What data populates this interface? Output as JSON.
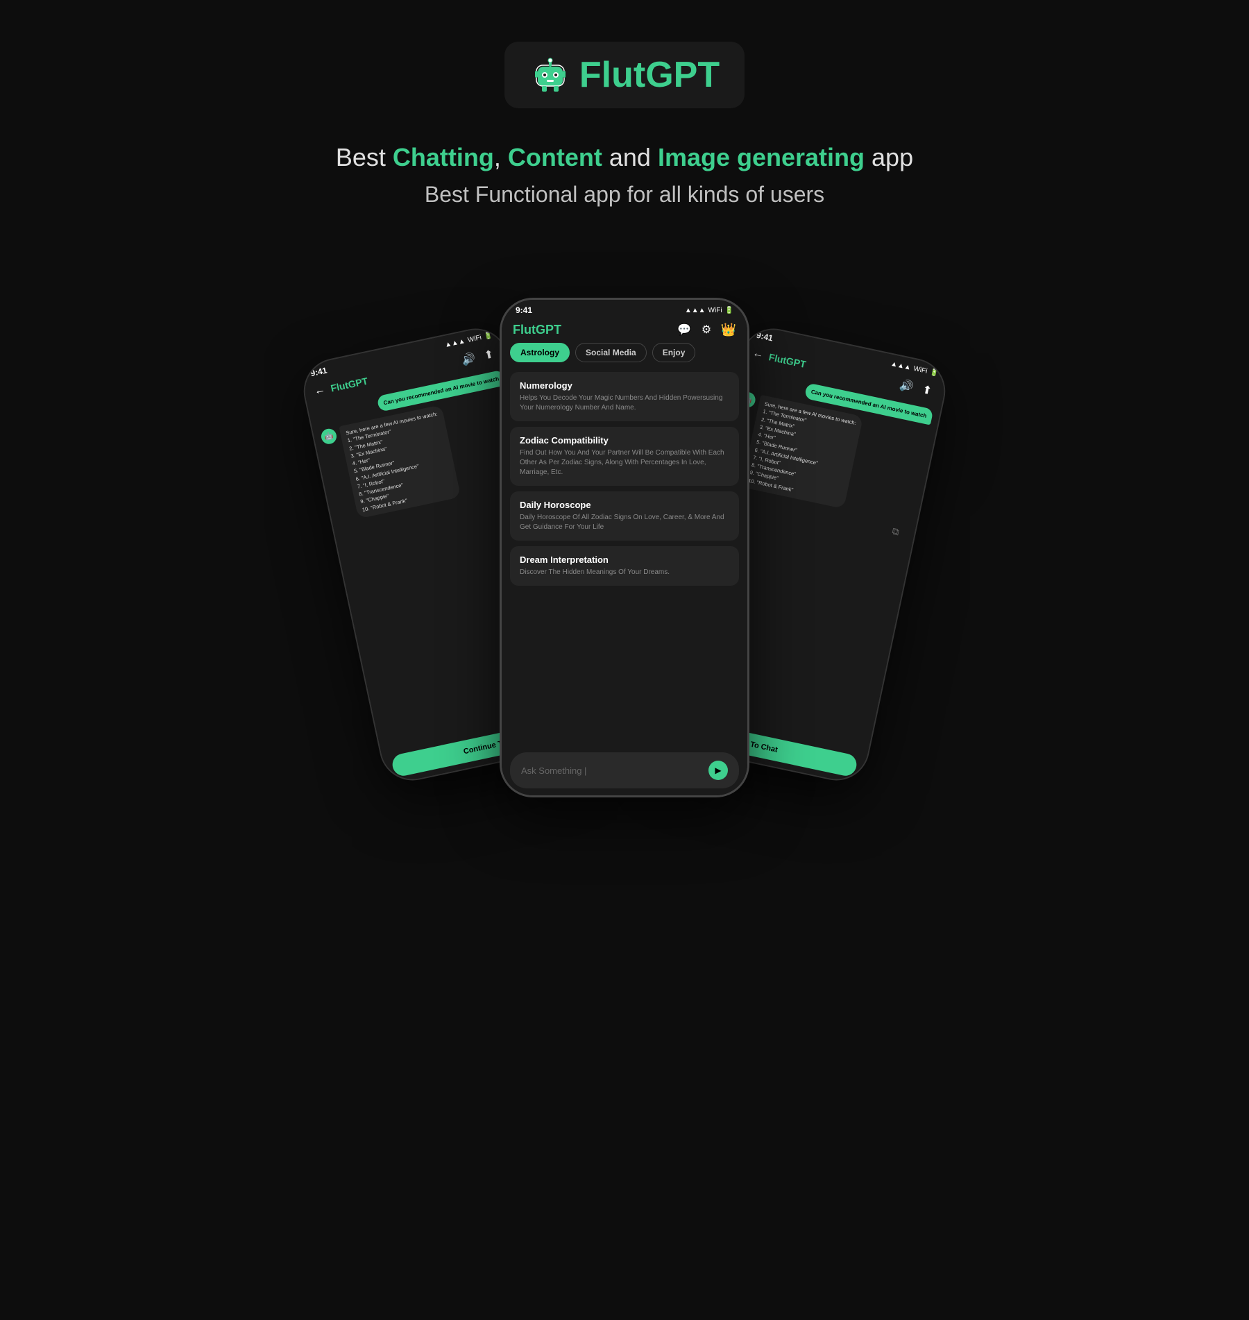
{
  "logo": {
    "text_white": "Flut",
    "text_green": "GPT"
  },
  "tagline1": {
    "prefix": "Best ",
    "word1": "Chatting",
    "sep1": ", ",
    "word2": "Content",
    "sep2": " and ",
    "word3": "Image generating",
    "suffix": " app"
  },
  "tagline2": "Best Functional app for all kinds of users",
  "center_phone": {
    "status_time": "9:41",
    "app_name_white": "Flut",
    "app_name_green": "GPT",
    "tabs": [
      "Astrology",
      "Social Media",
      "Enjoy"
    ],
    "active_tab": 0,
    "categories": [
      {
        "title": "Numerology",
        "desc": "Helps You Decode Your Magic Numbers And Hidden Powersusing Your Numerology Number And Name."
      },
      {
        "title": "Zodiac Compatibility",
        "desc": "Find Out How You And Your Partner Will Be Compatible With Each Other As Per Zodiac Signs, Along With Percentages In Love, Marriage, Etc."
      },
      {
        "title": "Daily Horoscope",
        "desc": "Daily Horoscope Of All Zodiac Signs On Love, Career, & More And Get Guidance For Your Life"
      },
      {
        "title": "Dream Interpretation",
        "desc": "Discover The Hidden Meanings Of Your Dreams."
      }
    ],
    "ask_placeholder": "Ask Something |",
    "send_label": "▶"
  },
  "left_phone": {
    "status_time": "9:41",
    "app_name_white": "Flut",
    "app_name_green": "GPT",
    "user_msg": "Can you recommended an AI movie to watch",
    "bot_msg": "Sure, here are a few AI movies to watch:\n1. \"The Terminator\"\n2. \"The Matrix\"\n3. \"Ex Machina\"\n4. \"Her\"\n5. \"Blade Runner\"\n6. \"A.I. Artificial Intelligence\"\n7. \"I, Robot\"\n8. \"Transcendence\"\n9. \"Chappie\"\n10. \"Robot & Frank\"",
    "continue_btn": "Continue To"
  },
  "right_phone": {
    "status_time": "9:41",
    "app_name_white": "Flut",
    "app_name_green": "GPT",
    "user_msg": "Can you recommended an AI movie to watch",
    "bot_msg": "Sure, here are a few AI movies to watch:\n1. \"The Terminator\"\n2. \"The Matrix\"\n3. \"Ex Machina\"\n4. \"Her\"\n5. \"Blade Runner\"\n6. \"A.I. Artificial Intelligence\"\n7. \"I, Robot\"\n8. \"Transcendence\"\n9. \"Chappie\"\n10. \"Robot & Frank\"",
    "continue_btn": "To Chat"
  }
}
